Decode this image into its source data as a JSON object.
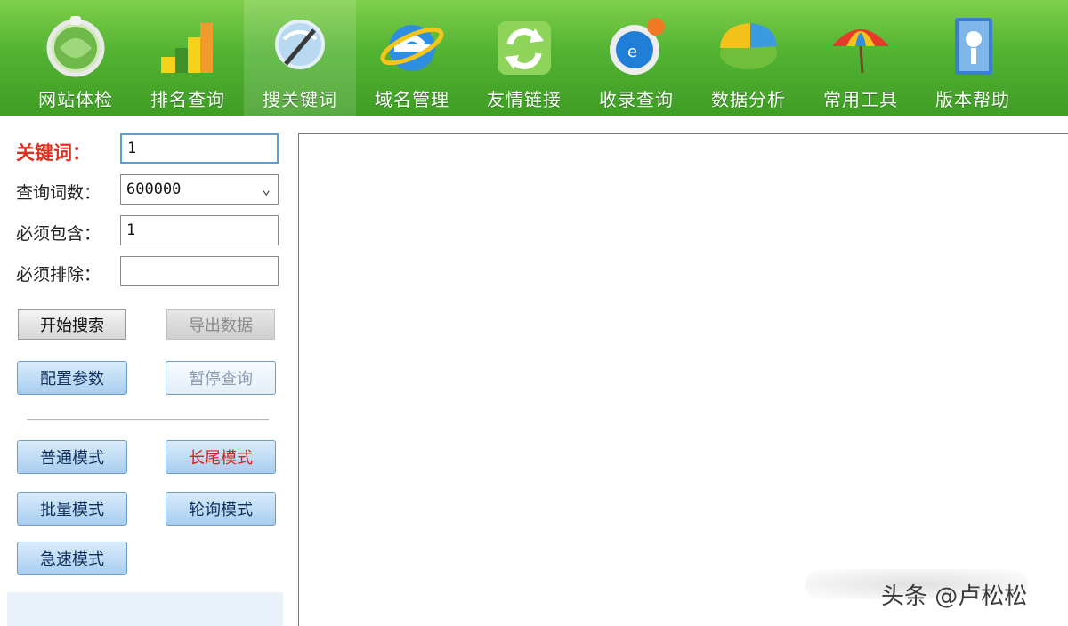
{
  "toolbar": {
    "items": [
      {
        "label": "网站体检",
        "icon": "magnifier-globe-icon"
      },
      {
        "label": "排名查询",
        "icon": "bar-chart-icon"
      },
      {
        "label": "搜关键词",
        "icon": "search-glass-icon"
      },
      {
        "label": "域名管理",
        "icon": "ie-browser-icon"
      },
      {
        "label": "友情链接",
        "icon": "refresh-arrows-icon"
      },
      {
        "label": "收录查询",
        "icon": "globe-clock-icon"
      },
      {
        "label": "数据分析",
        "icon": "pie-chart-icon"
      },
      {
        "label": "常用工具",
        "icon": "umbrella-icon"
      },
      {
        "label": "版本帮助",
        "icon": "help-book-icon"
      }
    ],
    "active_index": 2
  },
  "form": {
    "keyword_label": "关键词：",
    "keyword_value": "1",
    "count_label": "查询词数：",
    "count_value": "600000",
    "include_label": "必须包含：",
    "include_value": "1",
    "exclude_label": "必须排除：",
    "exclude_value": ""
  },
  "buttons": {
    "start_search": "开始搜索",
    "export_data": "导出数据",
    "config_params": "配置参数",
    "stop_query": "暂停查询",
    "normal_mode": "普通模式",
    "longtail_mode": "长尾模式",
    "batch_mode": "批量模式",
    "rotate_mode": "轮询模式",
    "fast_mode": "急速模式"
  },
  "watermark": "头条 @卢松松",
  "colors": {
    "toolbar_green": "#52b332",
    "keyword_red": "#e03020",
    "longtail_red": "#d9201a"
  }
}
